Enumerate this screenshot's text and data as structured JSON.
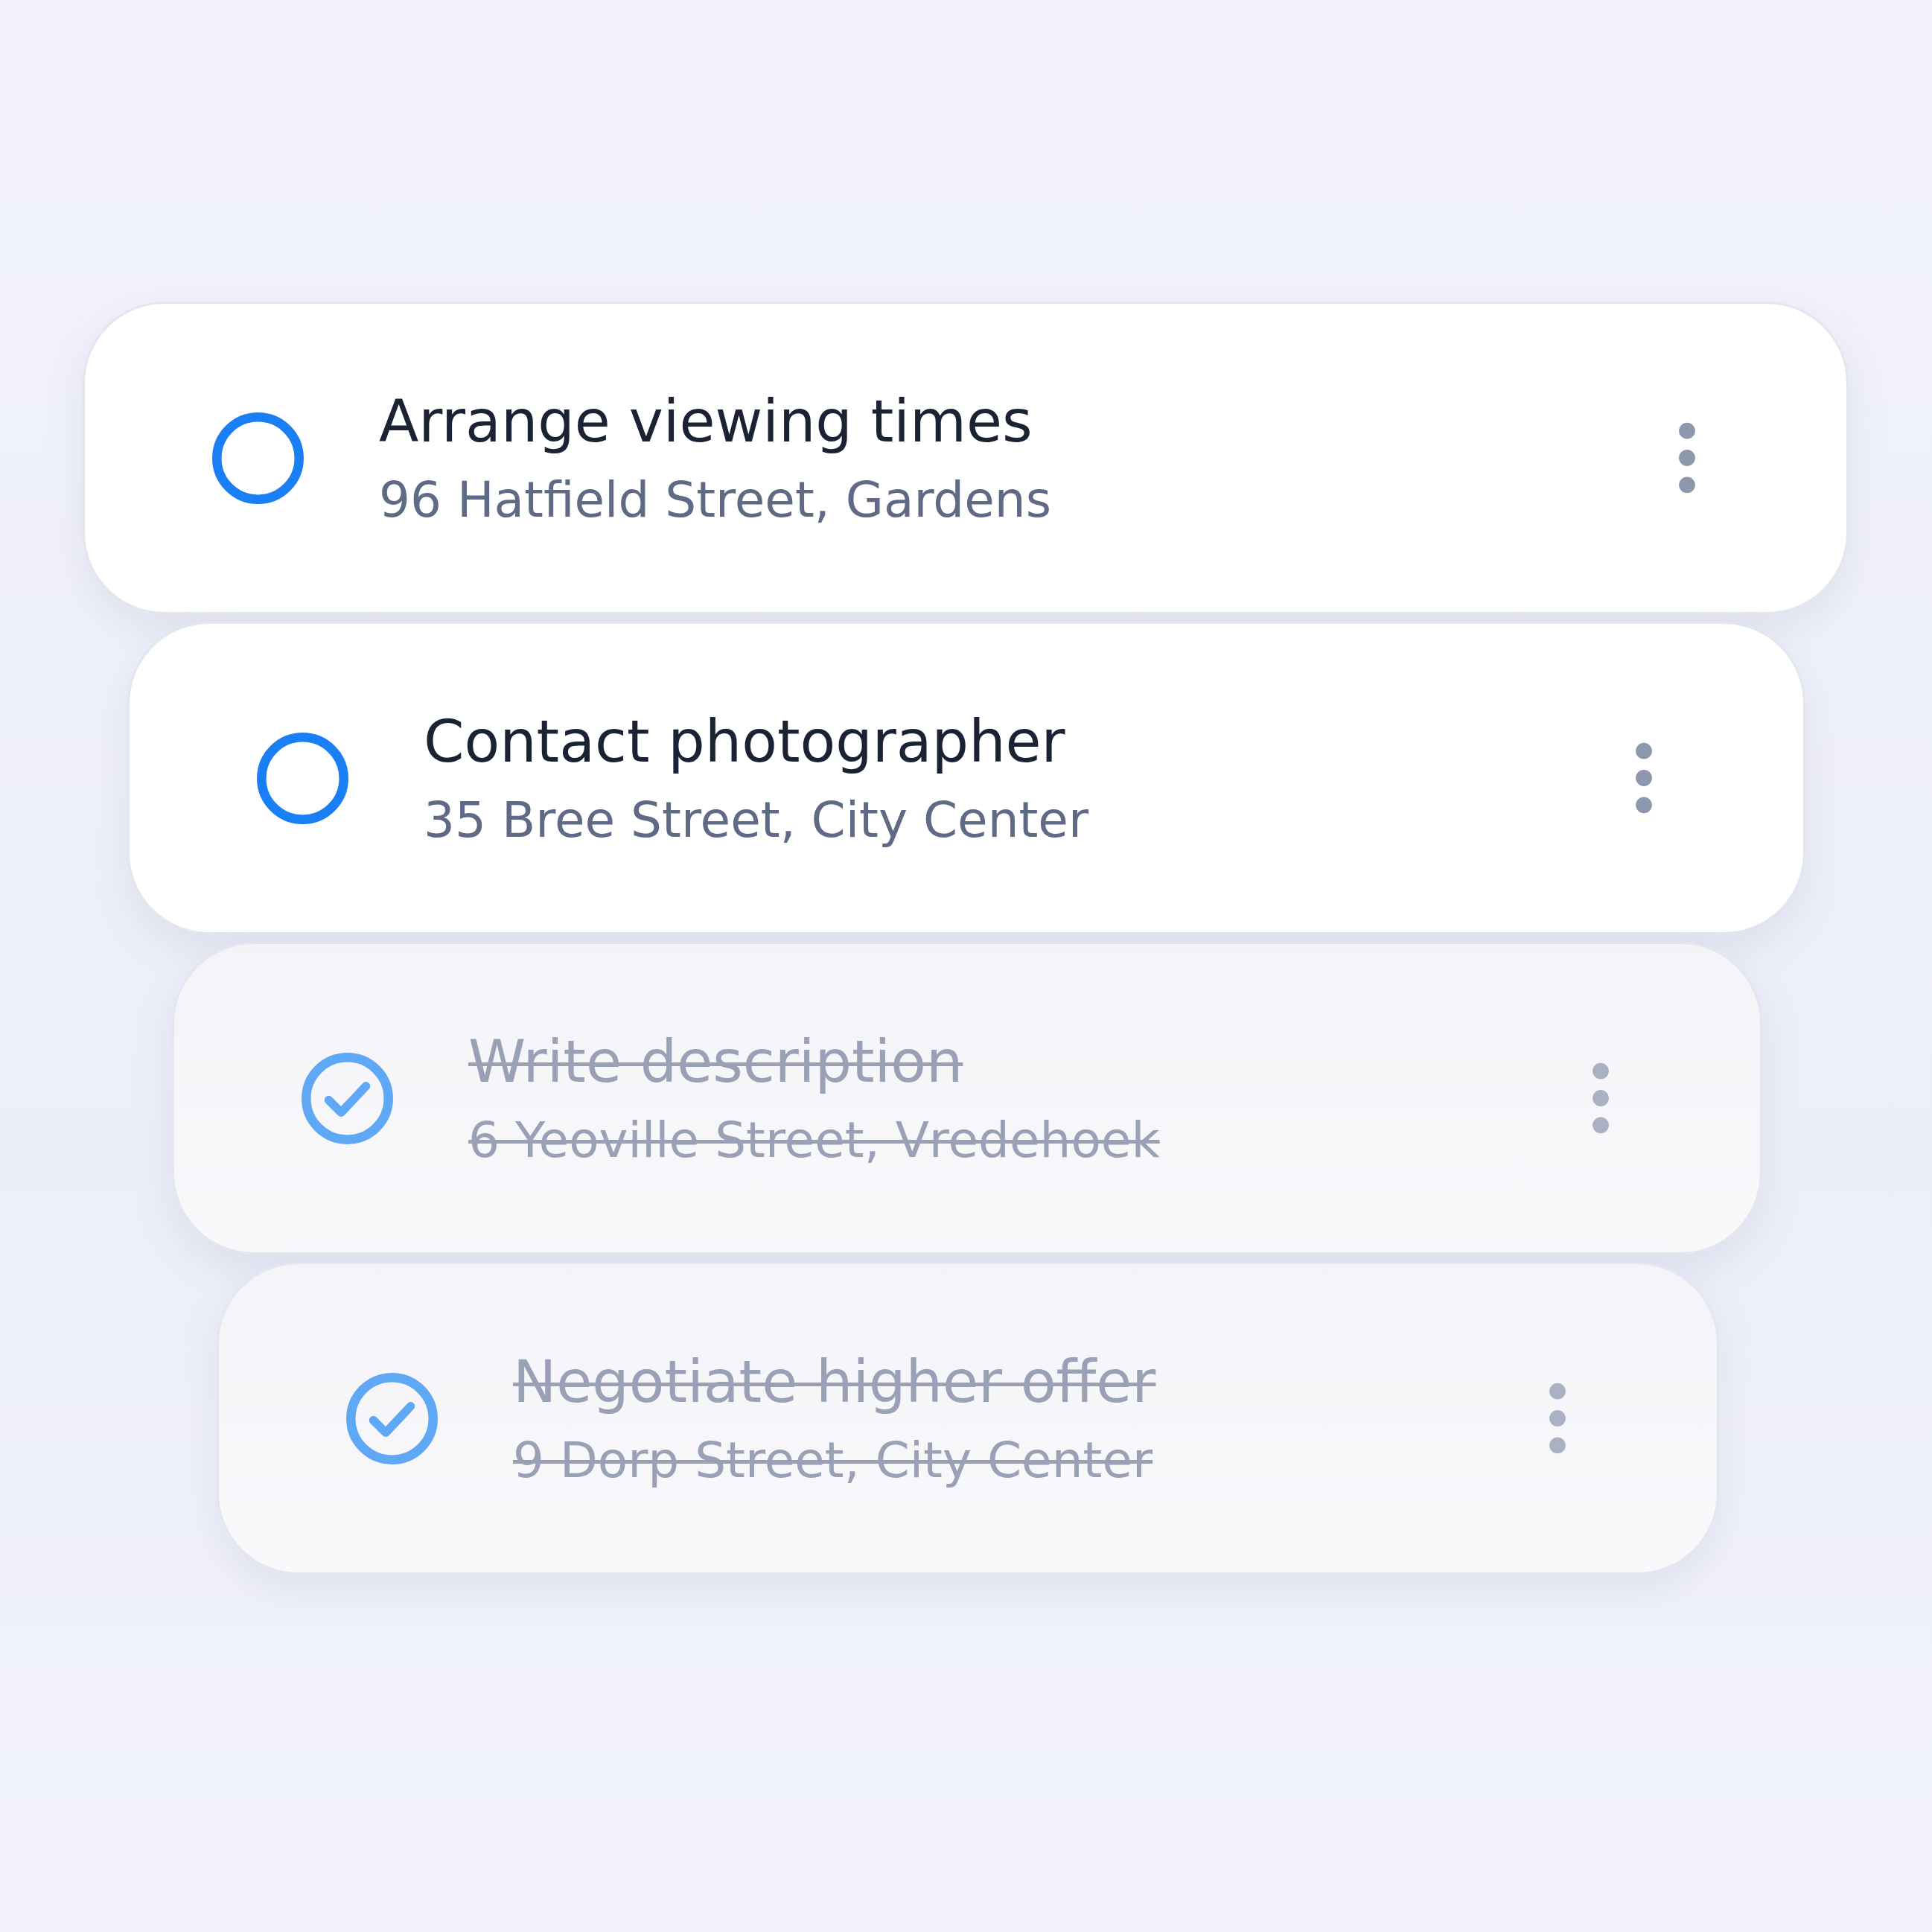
{
  "tasks": [
    {
      "title": "Arrange viewing times",
      "address": "96 Hatfield Street, Gardens",
      "done": false
    },
    {
      "title": "Contact photographer",
      "address": "35 Bree Street, City Center",
      "done": false
    },
    {
      "title": "Write description",
      "address": "6 Yeoville Street, Vredehoek",
      "done": true
    },
    {
      "title": "Negotiate higher offer",
      "address": "9 Dorp Street, City Center",
      "done": true
    }
  ]
}
